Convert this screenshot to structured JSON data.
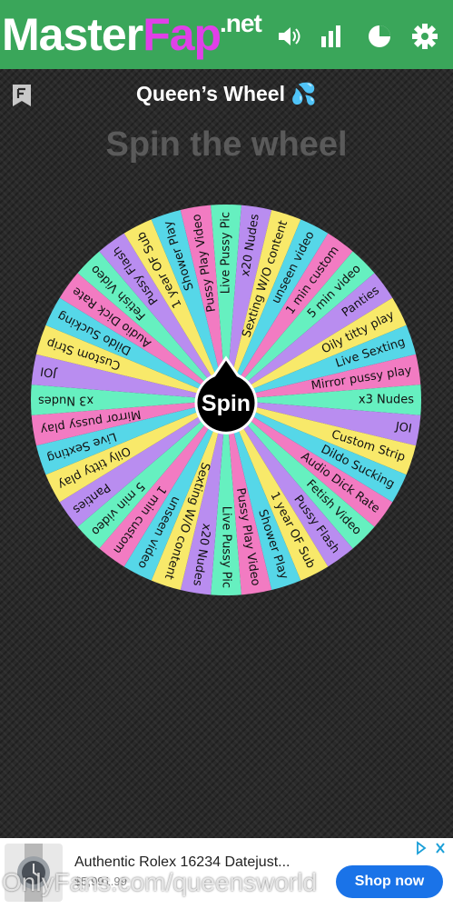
{
  "header": {
    "logo_master": "Master",
    "logo_fap": "Fap",
    "logo_net": ".net",
    "brand_color": "#3aa65a",
    "icons": [
      "sound-icon",
      "stats-icon",
      "pie-icon",
      "gear-icon"
    ]
  },
  "page": {
    "title": "Queen’s Wheel 💦",
    "subtitle": "Spin the wheel",
    "spin_label": "Spin"
  },
  "wheel": {
    "slices": [
      "x20 Nudes",
      "Sexting W/O content",
      "unseen video",
      "1 min custom",
      "5 min video",
      "Panties",
      "Oily titty play",
      "Live Sexting",
      "Mirror pussy play",
      "x3 Nudes",
      "JOI",
      "Custom Strip",
      "Dildo Sucking",
      "Audio Dick Rate",
      "Fetish Video",
      "Pussy Flash",
      "1 year OF Sub",
      "Shower Play",
      "Pussy Play Video",
      "Live Pussy Pic",
      "x20 Nudes",
      "Sexting W/O content",
      "unseen video",
      "1 min custom",
      "5 min video",
      "Panties",
      "Oily titty play",
      "Live Sexting",
      "Mirror pussy play",
      "x3 Nudes",
      "JOI",
      "Custom Strip",
      "Dildo Sucking",
      "Audio Dick Rate",
      "Fetish Video",
      "Pussy Flash",
      "1 year OF Sub",
      "Shower Play",
      "Pussy Play Video",
      "Live Pussy Pic"
    ],
    "colors": [
      "#b98df0",
      "#f8e96a",
      "#56d7e8",
      "#f27bc2",
      "#66f0c0"
    ]
  },
  "ad": {
    "title": "Authentic Rolex 16234 Datejust...",
    "price": "$5,991.99",
    "button": "Shop now"
  },
  "watermark": "OnlyFans.com/queensworld"
}
